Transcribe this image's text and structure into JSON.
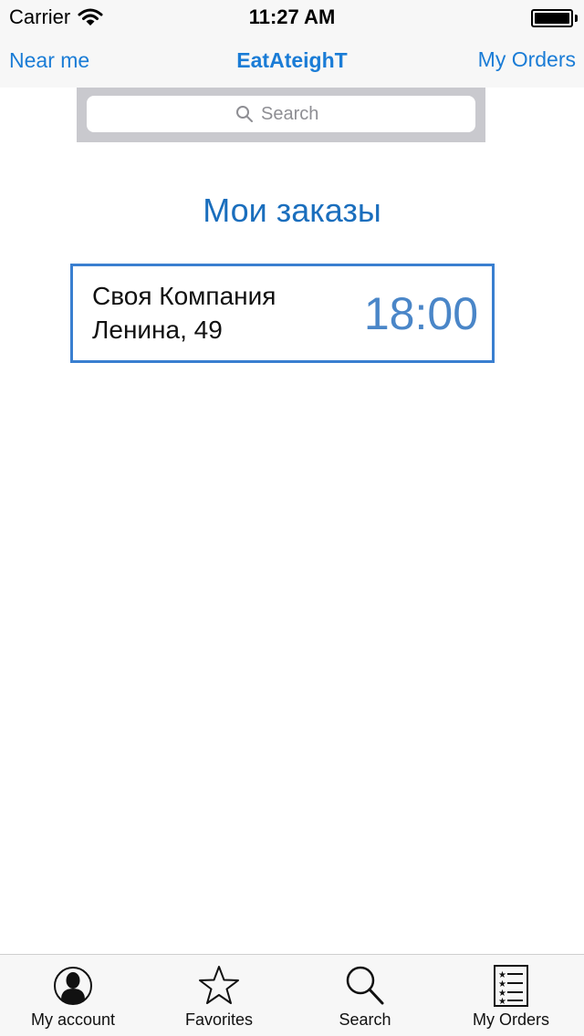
{
  "status_bar": {
    "carrier": "Carrier",
    "time": "11:27 AM",
    "battery_level": 1.0
  },
  "nav": {
    "left_label": "Near me",
    "title": "EatAteighT",
    "right_label": "My Orders"
  },
  "search": {
    "placeholder": "Search"
  },
  "main": {
    "heading": "Мои заказы",
    "orders": [
      {
        "name": "Своя Компания",
        "address": "Ленина, 49",
        "time": "18:00"
      }
    ]
  },
  "tabs": [
    {
      "label": "My account",
      "icon": "person-icon"
    },
    {
      "label": "Favorites",
      "icon": "star-icon"
    },
    {
      "label": "Search",
      "icon": "magnifier-icon"
    },
    {
      "label": "My Orders",
      "icon": "list-icon"
    }
  ],
  "colors": {
    "accent": "#1a7cd6",
    "card_border": "#3a7fd0",
    "time_text": "#4a86c8"
  }
}
